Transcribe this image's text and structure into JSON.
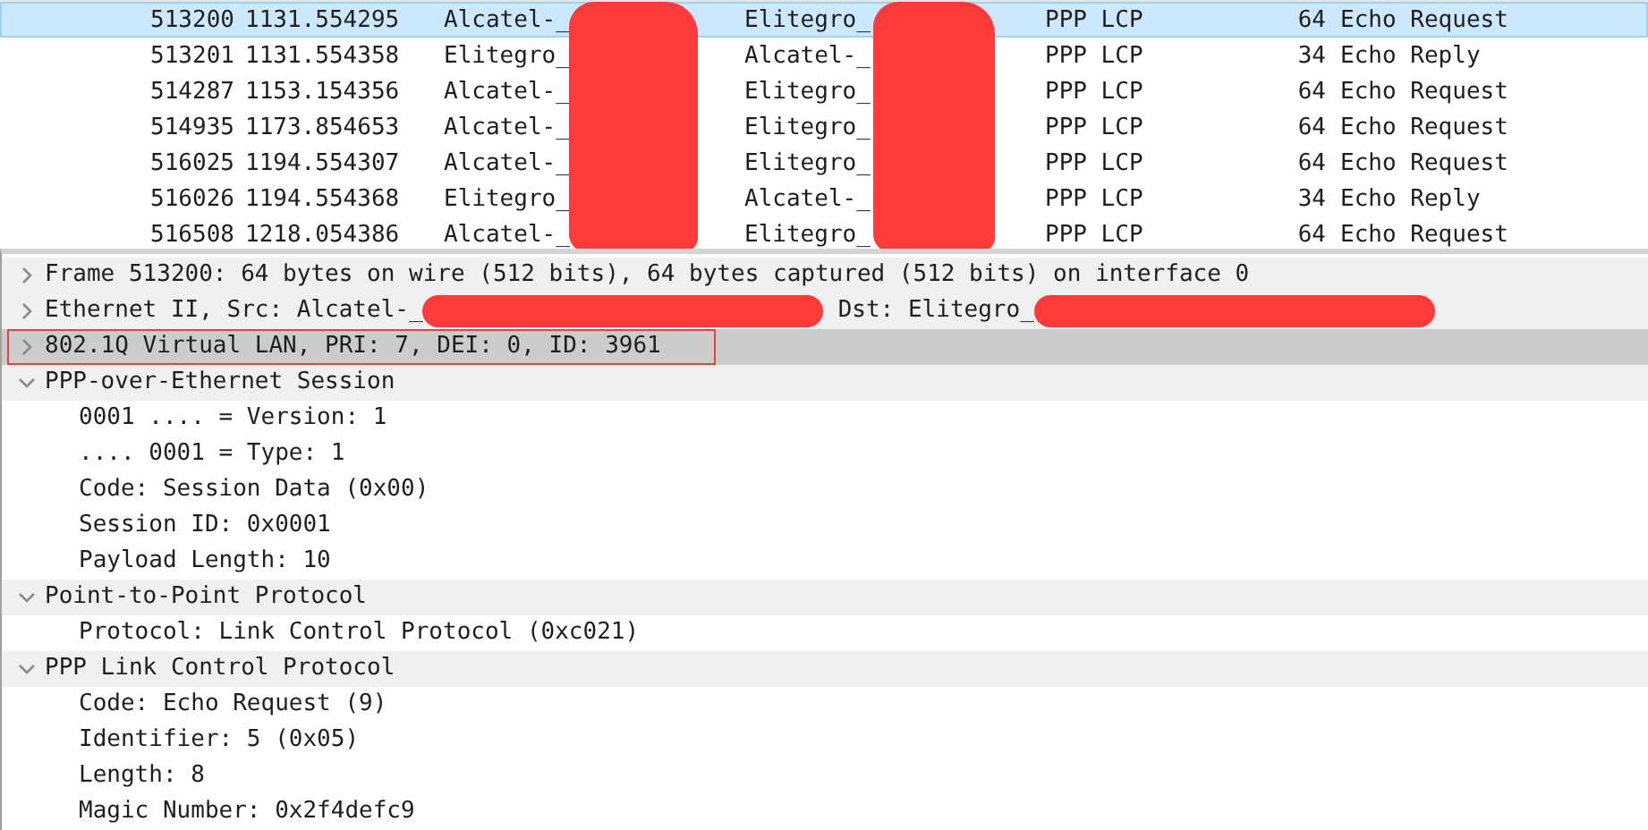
{
  "packet_list": {
    "redact_source": true,
    "redact_destination": true,
    "rows": [
      {
        "no": "513200",
        "time": "1131.554295",
        "source": "Alcatel-_",
        "destination": "Elitegro_",
        "protocol": "PPP LCP",
        "length": "64",
        "info": "Echo Request",
        "selected": true
      },
      {
        "no": "513201",
        "time": "1131.554358",
        "source": "Elitegro_",
        "destination": "Alcatel-_",
        "protocol": "PPP LCP",
        "length": "34",
        "info": "Echo Reply",
        "selected": false
      },
      {
        "no": "514287",
        "time": "1153.154356",
        "source": "Alcatel-_",
        "destination": "Elitegro_",
        "protocol": "PPP LCP",
        "length": "64",
        "info": "Echo Request",
        "selected": false
      },
      {
        "no": "514935",
        "time": "1173.854653",
        "source": "Alcatel-_",
        "destination": "Elitegro_",
        "protocol": "PPP LCP",
        "length": "64",
        "info": "Echo Request",
        "selected": false
      },
      {
        "no": "516025",
        "time": "1194.554307",
        "source": "Alcatel-_",
        "destination": "Elitegro_",
        "protocol": "PPP LCP",
        "length": "64",
        "info": "Echo Request",
        "selected": false
      },
      {
        "no": "516026",
        "time": "1194.554368",
        "source": "Elitegro_",
        "destination": "Alcatel-_",
        "protocol": "PPP LCP",
        "length": "34",
        "info": "Echo Reply",
        "selected": false
      },
      {
        "no": "516508",
        "time": "1218.054386",
        "source": "Alcatel-_",
        "destination": "Elitegro_",
        "protocol": "PPP LCP",
        "length": "64",
        "info": "Echo Request",
        "selected": false
      }
    ]
  },
  "packet_details": [
    {
      "segments": [
        {
          "text": "Frame 513200: 64 bytes on wire (512 bits), 64 bytes captured (512 bits) on interface 0",
          "redacted_after": false
        }
      ],
      "expanded": false,
      "selected": false
    },
    {
      "segments": [
        {
          "text": "Ethernet II, Src: Alcatel-_",
          "redacted_after": true
        },
        {
          "text": "Dst: Elitegro_",
          "redacted_after": true
        }
      ],
      "expanded": false,
      "selected": false
    },
    {
      "segments": [
        {
          "text": "802.1Q Virtual LAN, PRI: 7, DEI: 0, ID: 3961",
          "redacted_after": false
        }
      ],
      "expanded": false,
      "selected": true
    },
    {
      "segments": [
        {
          "text": "PPP-over-Ethernet Session",
          "redacted_after": false
        }
      ],
      "expanded": true,
      "selected": false,
      "children": [
        "0001 .... = Version: 1",
        ".... 0001 = Type: 1",
        "Code: Session Data (0x00)",
        "Session ID: 0x0001",
        "Payload Length: 10"
      ]
    },
    {
      "segments": [
        {
          "text": "Point-to-Point Protocol",
          "redacted_after": false
        }
      ],
      "expanded": true,
      "selected": false,
      "children": [
        "Protocol: Link Control Protocol (0xc021)"
      ]
    },
    {
      "segments": [
        {
          "text": "PPP Link Control Protocol",
          "redacted_after": false
        }
      ],
      "expanded": true,
      "selected": false,
      "children": [
        "Code: Echo Request (9)",
        "Identifier: 5 (0x05)",
        "Length: 8",
        "Magic Number: 0x2f4defc9"
      ]
    }
  ]
}
